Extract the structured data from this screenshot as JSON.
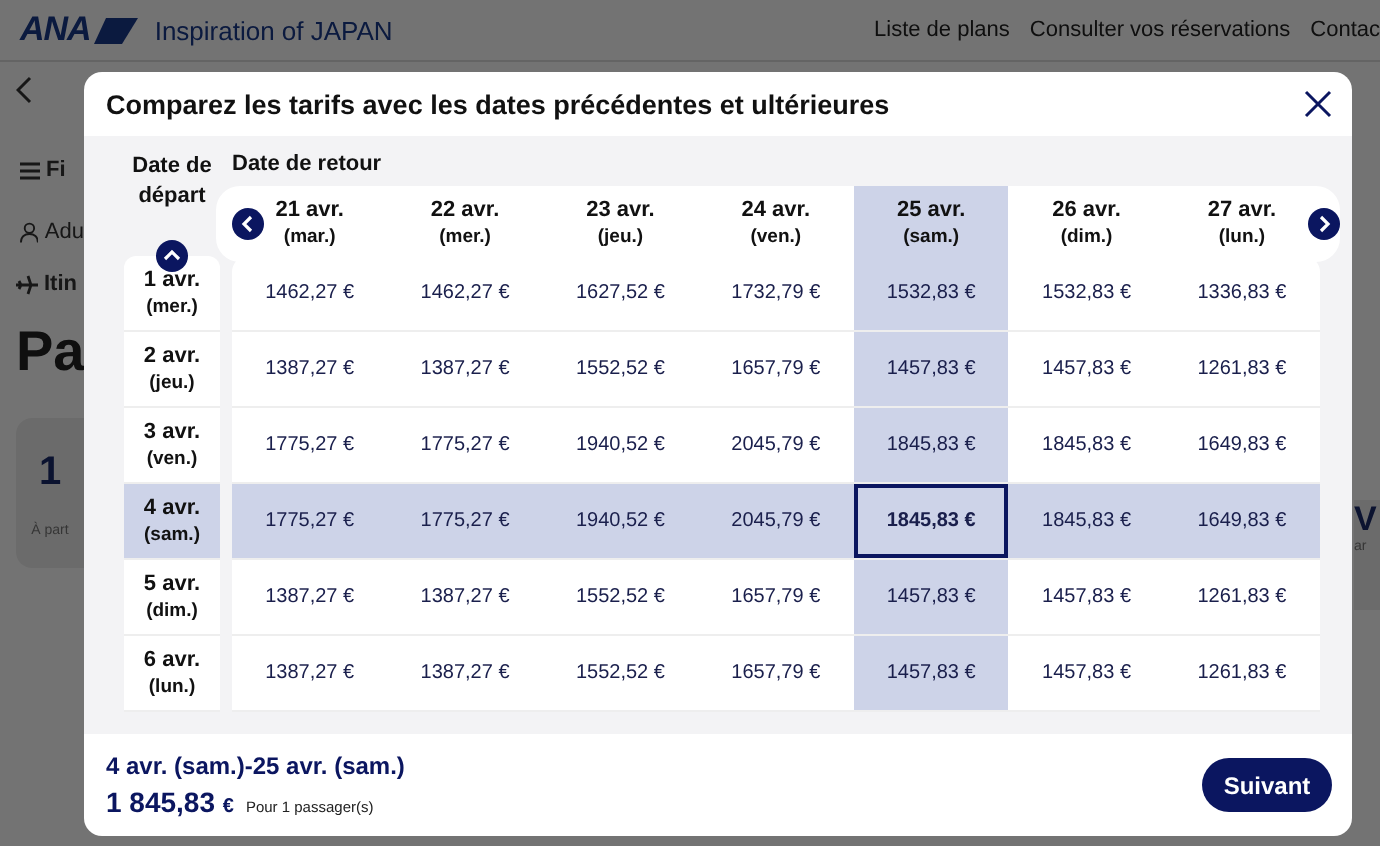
{
  "page": {
    "logo": "ANA",
    "tagline": "Inspiration of JAPAN",
    "nav_links": [
      "Liste de plans",
      "Consulter vos réservations",
      "Contac"
    ],
    "left_fragments": {
      "filter": "Fi",
      "passengers": "Adu",
      "itinerary": "Itin",
      "heading": "Pa",
      "card_value": "1",
      "card_note": "À part"
    },
    "right_fragments": {
      "card_value": "V",
      "card_note": "ar"
    }
  },
  "dialog": {
    "title": "Comparez les tarifs avec les dates précédentes et ultérieures",
    "departure_header": "Date de départ",
    "return_header": "Date de retour",
    "return_dates": [
      {
        "date": "21 avr.",
        "weekday": "(mar.)",
        "selected": false
      },
      {
        "date": "22 avr.",
        "weekday": "(mer.)",
        "selected": false
      },
      {
        "date": "23 avr.",
        "weekday": "(jeu.)",
        "selected": false
      },
      {
        "date": "24 avr.",
        "weekday": "(ven.)",
        "selected": false
      },
      {
        "date": "25 avr.",
        "weekday": "(sam.)",
        "selected": true
      },
      {
        "date": "26 avr.",
        "weekday": "(dim.)",
        "selected": false
      },
      {
        "date": "27 avr.",
        "weekday": "(lun.)",
        "selected": false
      }
    ],
    "departure_dates": [
      {
        "date": "1 avr.",
        "weekday": "(mer.)",
        "selected": false,
        "prices": [
          "1462,27 €",
          "1462,27 €",
          "1627,52 €",
          "1732,79 €",
          "1532,83 €",
          "1532,83 €",
          "1336,83 €"
        ]
      },
      {
        "date": "2 avr.",
        "weekday": "(jeu.)",
        "selected": false,
        "prices": [
          "1387,27 €",
          "1387,27 €",
          "1552,52 €",
          "1657,79 €",
          "1457,83 €",
          "1457,83 €",
          "1261,83 €"
        ]
      },
      {
        "date": "3 avr.",
        "weekday": "(ven.)",
        "selected": false,
        "prices": [
          "1775,27 €",
          "1775,27 €",
          "1940,52 €",
          "2045,79 €",
          "1845,83 €",
          "1845,83 €",
          "1649,83 €"
        ]
      },
      {
        "date": "4 avr.",
        "weekday": "(sam.)",
        "selected": true,
        "prices": [
          "1775,27 €",
          "1775,27 €",
          "1940,52 €",
          "2045,79 €",
          "1845,83 €",
          "1845,83 €",
          "1649,83 €"
        ]
      },
      {
        "date": "5 avr.",
        "weekday": "(dim.)",
        "selected": false,
        "prices": [
          "1387,27 €",
          "1387,27 €",
          "1552,52 €",
          "1657,79 €",
          "1457,83 €",
          "1457,83 €",
          "1261,83 €"
        ]
      },
      {
        "date": "6 avr.",
        "weekday": "(lun.)",
        "selected": false,
        "prices": [
          "1387,27 €",
          "1387,27 €",
          "1552,52 €",
          "1657,79 €",
          "1457,83 €",
          "1457,83 €",
          "1261,83 €"
        ]
      }
    ],
    "summary": {
      "dates": "4 avr. (sam.)-25 avr. (sam.)",
      "price": "1 845,83",
      "currency": "€",
      "note": "Pour 1 passager(s)"
    },
    "next_button": "Suivant"
  }
}
